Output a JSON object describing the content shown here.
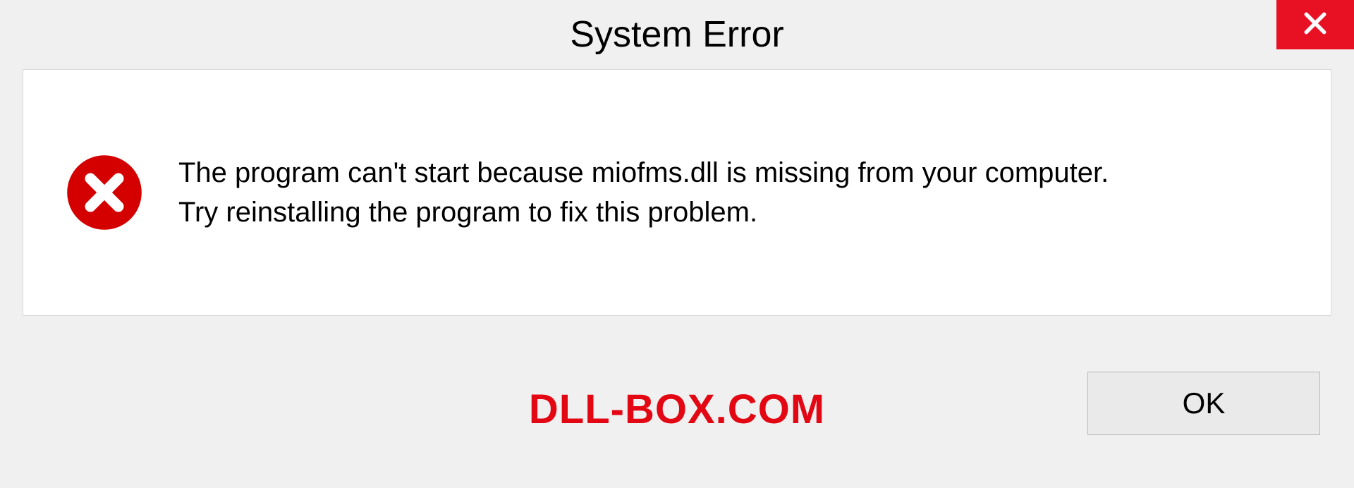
{
  "titlebar": {
    "title": "System Error"
  },
  "message": {
    "line1": "The program can't start because miofms.dll is missing from your computer.",
    "line2": "Try reinstalling the program to fix this problem."
  },
  "footer": {
    "watermark": "DLL-BOX.COM",
    "ok_label": "OK"
  },
  "colors": {
    "close_bg": "#e81123",
    "error_icon": "#d40000",
    "watermark": "#e30613"
  }
}
